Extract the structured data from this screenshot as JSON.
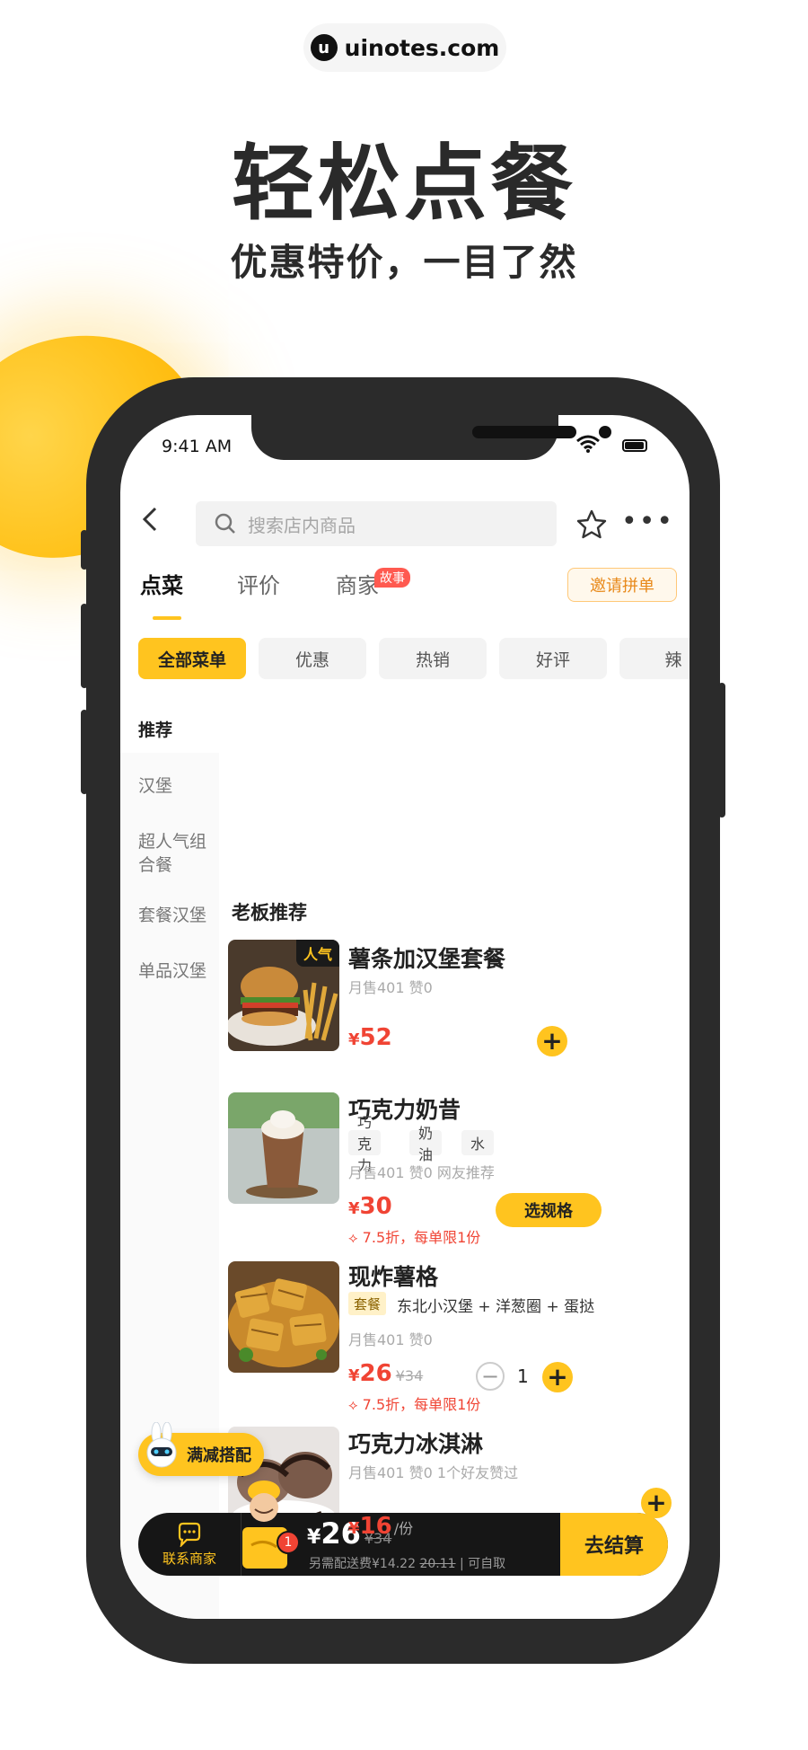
{
  "brand": {
    "logo_glyph": "u",
    "name": "uinotes.com"
  },
  "headline": "轻松点餐",
  "subheadline": "优惠特价，一目了然",
  "status_bar": {
    "time": "9:41 AM"
  },
  "search": {
    "placeholder": "搜索店内商品"
  },
  "tabs": [
    {
      "label": "点菜",
      "active": true
    },
    {
      "label": "评价",
      "active": false
    },
    {
      "label": "商家",
      "active": false
    }
  ],
  "story_badge": "故事",
  "invite_button": "邀请拼单",
  "chips": [
    {
      "label": "全部菜单",
      "active": true
    },
    {
      "label": "优惠",
      "active": false
    },
    {
      "label": "热销",
      "active": false
    },
    {
      "label": "好评",
      "active": false
    },
    {
      "label": "辣",
      "active": false
    }
  ],
  "sidebar": {
    "items": [
      {
        "label": "推荐",
        "active": true
      },
      {
        "label": "汉堡",
        "active": false
      },
      {
        "label": "超人气组合餐",
        "active": false
      },
      {
        "label": "套餐汉堡",
        "active": false
      },
      {
        "label": "单品汉堡",
        "active": false
      }
    ]
  },
  "section_title": "老板推荐",
  "dishes": [
    {
      "name": "薯条加汉堡套餐",
      "badge": "人气",
      "meta": "月售401   赞0",
      "currency": "¥",
      "price": "52"
    },
    {
      "name": "巧克力奶昔",
      "tags": [
        "巧克力",
        "奶油",
        "水"
      ],
      "meta": "月售401   赞0   网友推荐",
      "currency": "¥",
      "price": "30",
      "discount": "7.5折，每单限1份",
      "spec_button": "选规格"
    },
    {
      "name": "现炸薯格",
      "combo_tag": "套餐",
      "combo_items": "东北小汉堡 + 洋葱圈 + 蛋挞",
      "meta": "月售401   赞0",
      "currency": "¥",
      "price": "26",
      "original_price": "¥34",
      "discount": "7.5折，每单限1份",
      "quantity": "1"
    },
    {
      "name": "巧克力冰淇淋",
      "meta": "月售401   赞0   1个好友赞过",
      "currency": "¥",
      "price": "16",
      "unit": "/份"
    }
  ],
  "promo_pill": "满减搭配",
  "cart": {
    "contact_label": "联系商家",
    "count": "1",
    "currency": "¥",
    "total": "26",
    "original_total": "¥34",
    "fee_prefix": "另需配送费¥14.22",
    "fee_strike": "20.11",
    "fee_suffix": "| 可自取",
    "checkout": "去结算"
  },
  "colors": {
    "accent": "#ffc41f",
    "price": "#f04434",
    "dark": "#161616"
  }
}
